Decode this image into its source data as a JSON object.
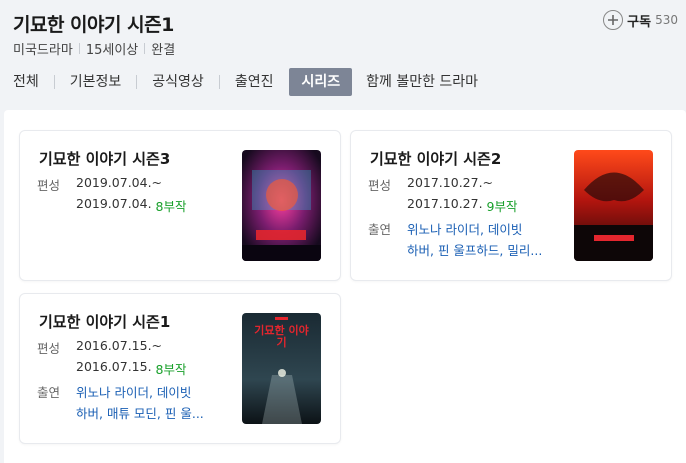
{
  "header": {
    "title": "기묘한 이야기 시즌1",
    "meta": [
      "미국드라마",
      "15세이상",
      "완결"
    ],
    "subscribe_label": "구독",
    "subscribe_count": "530"
  },
  "tabs": [
    {
      "label": "전체",
      "active": false
    },
    {
      "label": "기본정보",
      "active": false
    },
    {
      "label": "공식영상",
      "active": false
    },
    {
      "label": "출연진",
      "active": false
    },
    {
      "label": "시리즈",
      "active": true
    },
    {
      "label": "함께 볼만한 드라마",
      "active": false
    }
  ],
  "cards": [
    {
      "title": "기묘한 이야기 시즌3",
      "label_period": "편성",
      "date_start": "2019.07.04.~",
      "date_end": "2019.07.04.",
      "episodes": "8부작",
      "label_cast": "",
      "cast_line1": "",
      "cast_line2": "",
      "poster_text": ""
    },
    {
      "title": "기묘한 이야기 시즌2",
      "label_period": "편성",
      "date_start": "2017.10.27.~",
      "date_end": "2017.10.27.",
      "episodes": "9부작",
      "label_cast": "출연",
      "cast_line1": "위노나 라이더, 데이빗",
      "cast_line2": "하버, 핀 울프하드, 밀리...",
      "poster_text": ""
    },
    {
      "title": "기묘한 이야기 시즌1",
      "label_period": "편성",
      "date_start": "2016.07.15.~",
      "date_end": "2016.07.15.",
      "episodes": "8부작",
      "label_cast": "출연",
      "cast_line1": "위노나 라이더, 데이빗",
      "cast_line2": "하버, 매튜 모딘, 핀 울...",
      "poster_text": "기묘한 이야기"
    }
  ],
  "colors": {
    "episode_green": "#19a02b",
    "cast_blue": "#1a5fb4",
    "active_tab_bg": "#7d8596"
  }
}
